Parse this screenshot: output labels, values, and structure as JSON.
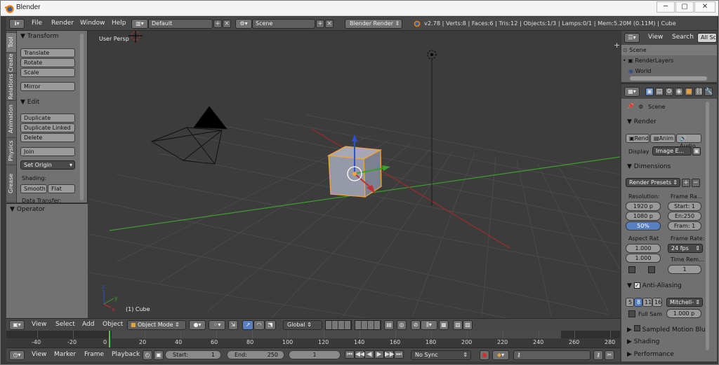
{
  "window": {
    "title": "Blender"
  },
  "menubar": {
    "items": [
      "File",
      "Render",
      "Window",
      "Help"
    ],
    "screen_layout": "Default",
    "scene": "Scene",
    "render_engine": "Blender Render",
    "stats": "v2.78 | Verts:8 | Faces:6 | Tris:12 | Objects:1/3 | Lamps:0/1 | Mem:5.20M (0.11M) | Cube"
  },
  "toolshelf": {
    "tabs": [
      "Tool",
      "Create",
      "Relations",
      "Animation",
      "Physics",
      "Grease Pencil"
    ],
    "transform_title": "Transform",
    "transform_buttons": [
      "Translate",
      "Rotate",
      "Scale",
      "Mirror"
    ],
    "edit_title": "Edit",
    "edit_buttons": [
      "Duplicate",
      "Duplicate Linked",
      "Delete",
      "Join"
    ],
    "set_origin": "Set Origin",
    "shading_label": "Shading:",
    "smooth": "Smooth",
    "flat": "Flat",
    "data_transfer": "Data Transfer:",
    "operator_title": "Operator"
  },
  "viewport": {
    "view_name": "User Persp",
    "object_label": "(1) Cube"
  },
  "view3d_header": {
    "menus": [
      "View",
      "Select",
      "Add",
      "Object"
    ],
    "mode": "Object Mode",
    "orientation": "Global"
  },
  "timeline": {
    "ticks": [
      "-40",
      "-20",
      "0",
      "20",
      "40",
      "60",
      "80",
      "100",
      "120",
      "140",
      "160",
      "180",
      "200",
      "220",
      "240",
      "260",
      "280"
    ],
    "current_frame_fraction": 0.45
  },
  "timeline_header": {
    "menus": [
      "View",
      "Marker",
      "Frame",
      "Playback"
    ],
    "start_label": "Start:",
    "start_value": "1",
    "end_label": "End:",
    "end_value": "250",
    "current_frame": "1",
    "sync": "No Sync"
  },
  "outliner": {
    "menus": [
      "View",
      "Search"
    ],
    "filter": "All Sc",
    "items": [
      "Scene",
      "RenderLayers",
      "World"
    ]
  },
  "properties": {
    "context": "Scene",
    "render_title": "Render",
    "render_buttons": [
      "Rend",
      "Anim",
      "Audio"
    ],
    "display_label": "Display",
    "display_value": "Image E...",
    "dimensions_title": "Dimensions",
    "render_presets": "Render Presets",
    "resolution_label": "Resolution:",
    "res_x": "1920 p",
    "res_y": "1080 p",
    "res_pct": "50%",
    "frame_range_label": "Frame Ra...",
    "frame_start": "Start: 1",
    "frame_end": "En:250",
    "frame_step": "Fram: 1",
    "aspect_label": "Aspect Rat",
    "aspect_x": "1.000",
    "aspect_y": "1.000",
    "frame_rate_label": "Frame Rate:",
    "frame_rate": "24 fps",
    "time_remap_label": "Time Rem...",
    "time_remap_value": "1",
    "aa_title": "Anti-Aliasing",
    "aa_samples": [
      "5",
      "8",
      "11",
      "16"
    ],
    "aa_filter": "Mitchell-",
    "full_sample": "Full Sam",
    "aa_size": "1.000 p",
    "motion_blur_title": "Sampled Motion Blur",
    "shading_title": "Shading",
    "performance_title": "Performance"
  },
  "colors": {
    "accent": "#5680c2",
    "selected_outline": "#f1a33a",
    "x_axis": "#c03030",
    "y_axis": "#5aa02a",
    "z_axis": "#3050d0"
  }
}
